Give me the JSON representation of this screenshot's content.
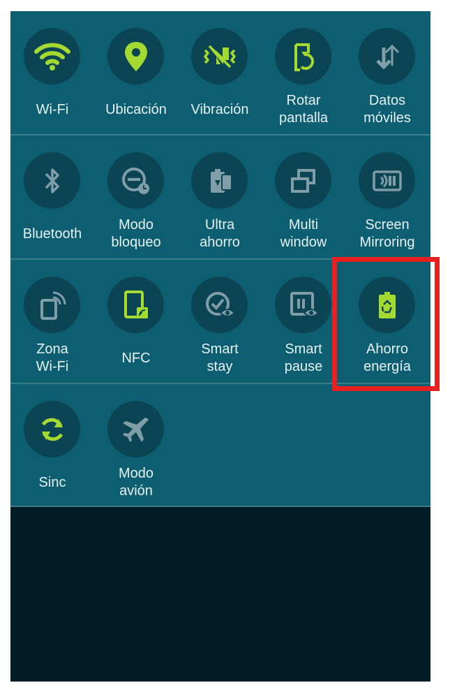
{
  "quick_settings": {
    "rows": [
      [
        {
          "label": "Wi-Fi",
          "icon": "wifi-icon",
          "active": true
        },
        {
          "label": "Ubicación",
          "icon": "location-pin-icon",
          "active": true
        },
        {
          "label": "Vibración",
          "icon": "vibration-icon",
          "active": true
        },
        {
          "label": "Rotar\npantalla",
          "icon": "rotate-screen-icon",
          "active": true
        },
        {
          "label": "Datos\nmóviles",
          "icon": "mobile-data-icon",
          "active": false
        }
      ],
      [
        {
          "label": "Bluetooth",
          "icon": "bluetooth-icon",
          "active": false
        },
        {
          "label": "Modo\nbloqueo",
          "icon": "blocking-mode-icon",
          "active": false
        },
        {
          "label": "Ultra\nahorro",
          "icon": "ultra-power-saving-icon",
          "active": false
        },
        {
          "label": "Multi\nwindow",
          "icon": "multi-window-icon",
          "active": false
        },
        {
          "label": "Screen\nMirroring",
          "icon": "screen-mirroring-icon",
          "active": false
        }
      ],
      [
        {
          "label": "Zona\nWi-Fi",
          "icon": "hotspot-icon",
          "active": false
        },
        {
          "label": "NFC",
          "icon": "nfc-icon",
          "active": true
        },
        {
          "label": "Smart\nstay",
          "icon": "smart-stay-icon",
          "active": false
        },
        {
          "label": "Smart\npause",
          "icon": "smart-pause-icon",
          "active": false
        },
        {
          "label": "Ahorro\nenergía",
          "icon": "power-saving-icon",
          "active": true,
          "highlighted": true
        }
      ],
      [
        {
          "label": "Sinc",
          "icon": "sync-icon",
          "active": true
        },
        {
          "label": "Modo\navión",
          "icon": "airplane-icon",
          "active": false
        }
      ]
    ]
  },
  "colors": {
    "panel_bg": "#0d5e70",
    "circle_bg": "#0b4553",
    "icon_active": "#a3d931",
    "icon_inactive": "#7f9ea7",
    "label_text": "#e6f1f3",
    "lower_screen_bg": "#011b24",
    "highlight_border": "#e8201f"
  }
}
